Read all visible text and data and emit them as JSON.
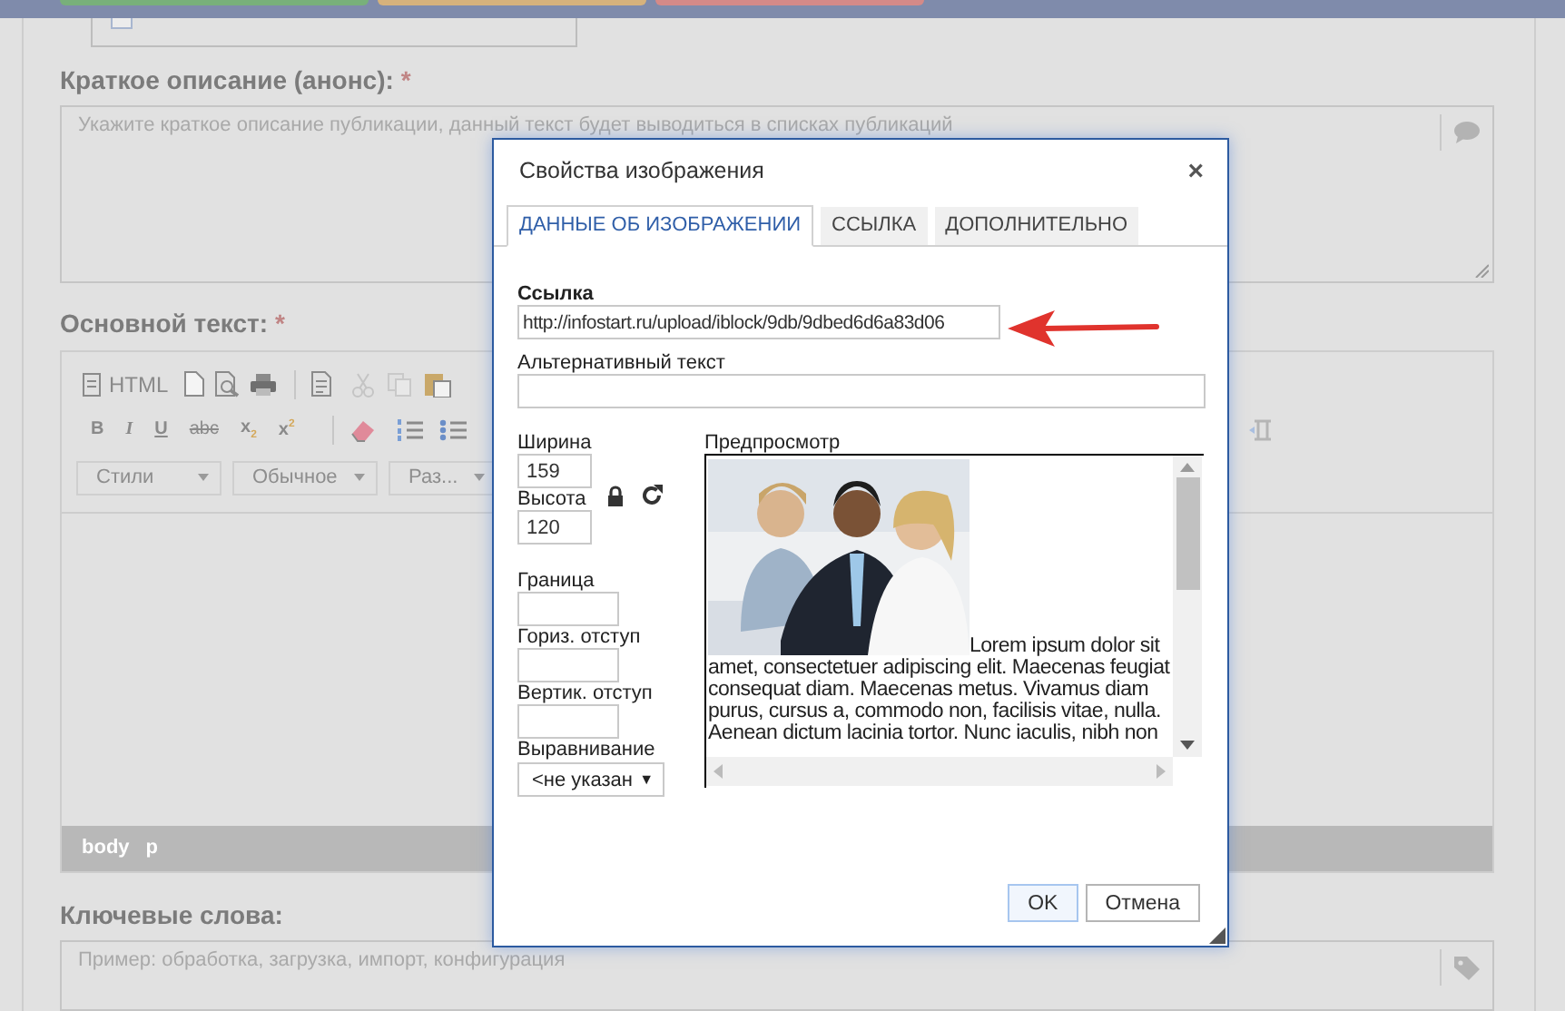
{
  "top_bar": {
    "buttons": [
      {
        "color": "#78b07a"
      },
      {
        "color": "#d6b27c"
      },
      {
        "color": "#d48a88"
      }
    ]
  },
  "checkbox_panel": {
    "checked": false
  },
  "announce": {
    "label": "Краткое описание (анонс):",
    "required_mark": "*",
    "placeholder": "Укажите краткое описание публикации, данный текст будет выводиться в списках публикаций"
  },
  "main_text": {
    "label": "Основной текст:",
    "required_mark": "*",
    "source_label": "HTML",
    "format_buttons": [
      "B",
      "I",
      "U",
      "abc",
      "x$_{2}$",
      "x$^{2}$"
    ],
    "dropdowns": [
      "Стили",
      "Обычное",
      "Раз..."
    ],
    "status_path": [
      "body",
      "p"
    ]
  },
  "keywords": {
    "label": "Ключевые слова:",
    "placeholder": "Пример: обработка, загрузка, импорт, конфигурация"
  },
  "dialog": {
    "title": "Свойства изображения",
    "close": "×",
    "tabs": [
      {
        "label": "ДАННЫЕ ОБ ИЗОБРАЖЕНИИ",
        "selected": true
      },
      {
        "label": "ССЫЛКА",
        "selected": false
      },
      {
        "label": "ДОПОЛНИТЕЛЬНО",
        "selected": false
      }
    ],
    "url": {
      "label": "Ссылка",
      "value": "http://infostart.ru/upload/iblock/9db/9dbed6d6a83d06"
    },
    "alt_text": {
      "label": "Альтернативный текст"
    },
    "width": {
      "label": "Ширина",
      "value": "159"
    },
    "height": {
      "label": "Высота",
      "value": "120"
    },
    "border": {
      "label": "Граница"
    },
    "hspace": {
      "label": "Гориз. отступ"
    },
    "vspace": {
      "label": "Вертик. отступ"
    },
    "align": {
      "label": "Выравнивание",
      "value": "<не указан",
      "caret": "▼"
    },
    "preview": {
      "label": "Предпросмотр",
      "text": "Lorem ipsum dolor sit amet, consectetuer adipiscing elit. Maecenas feugiat consequat diam. Maecenas metus. Vivamus diam purus, cursus a, commodo non, facilisis vitae, nulla. Aenean dictum lacinia tortor. Nunc iaculis, nibh non"
    },
    "buttons": [
      {
        "label": "OK",
        "default": true
      },
      {
        "label": "Отмена",
        "default": false
      }
    ]
  }
}
